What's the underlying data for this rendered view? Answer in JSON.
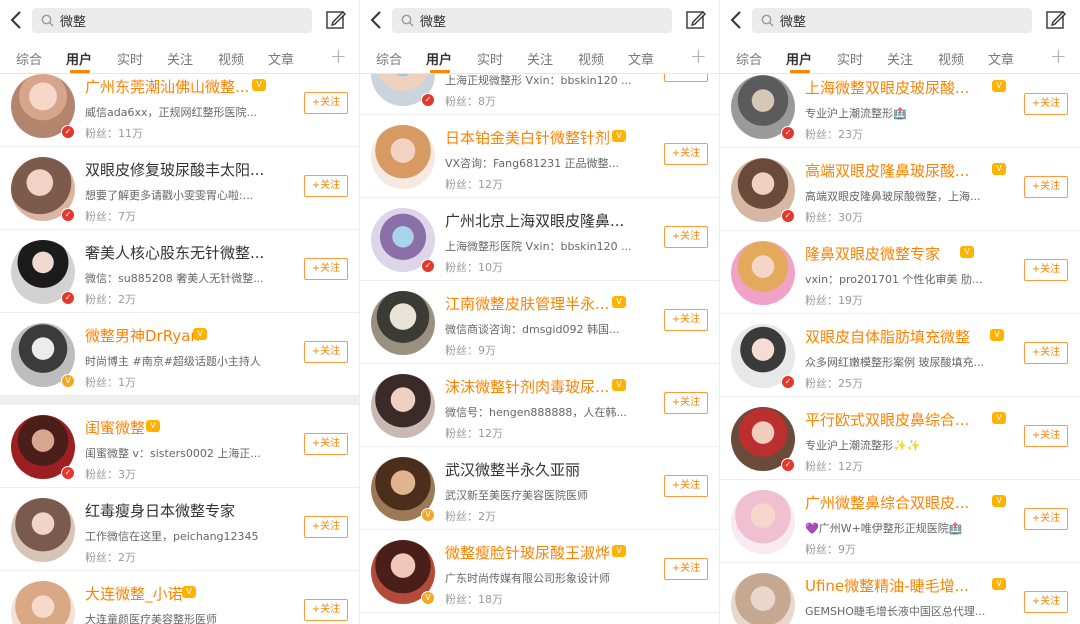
{
  "search": {
    "query": "微整"
  },
  "tabs": [
    "综合",
    "用户",
    "实时",
    "关注",
    "视频",
    "文章"
  ],
  "follow_label": "+关注",
  "colors": {
    "accent": "#ff8200",
    "verified_red": "#e5382c",
    "verified_gold": "#f5a623"
  },
  "panels": [
    {
      "users": [
        {
          "name": "广州东莞潮汕佛山微整...",
          "desc": "威信ada6xx，正规网红整形医院...",
          "fans": "粉丝：11万"
        },
        {
          "name": "双眼皮修复玻尿酸丰太阳...",
          "desc": "想要了解更多请戳小雯雯胃心啦:...",
          "fans": "粉丝：7万"
        },
        {
          "name": "奢美人核心股东无针微整...",
          "desc": "微信：su885208 奢美人无针微整...",
          "fans": "粉丝：2万"
        },
        {
          "name": "微整男神DrRyan",
          "desc": "时尚博主 #南京#超级话题小主持人",
          "fans": "粉丝：1万"
        },
        {
          "name": "闺蜜微整",
          "desc": "闺蜜微整 v：sisters0002 上海正...",
          "fans": "粉丝：3万"
        },
        {
          "name": "红毒瘦身日本微整专家",
          "desc": "工作微信在这里，peichang12345",
          "fans": "粉丝：2万"
        },
        {
          "name": "大连微整_小诺",
          "desc": "大连童颜医疗美容整形医师",
          "fans": ""
        }
      ]
    },
    {
      "users": [
        {
          "name": "",
          "desc": "上海正规微整形 Vxin：bbskin120 ...",
          "fans": "粉丝：8万"
        },
        {
          "name": "日本铂金美白针微整针剂",
          "desc": "VX咨询：Fang681231  正品微整...",
          "fans": "粉丝：12万"
        },
        {
          "name": "广州北京上海双眼皮隆鼻...",
          "desc": "上海微整形医院 Vxin：bbskin120 ...",
          "fans": "粉丝：10万"
        },
        {
          "name": "江南微整皮肤管理半永...",
          "desc": "微信商谈咨询：dmsgid092 韩国...",
          "fans": "粉丝：9万"
        },
        {
          "name": "沫沫微整针剂肉毒玻尿...",
          "desc": "微信号：hengen888888，人在韩...",
          "fans": "粉丝：12万"
        },
        {
          "name": "武汉微整半永久亚丽",
          "desc": "武汉新至美医疗美容医院医师",
          "fans": "粉丝：2万"
        },
        {
          "name": "微整瘦脸针玻尿酸王淑烨",
          "desc": "广东时尚传媒有限公司形象设计师",
          "fans": "粉丝：18万"
        }
      ]
    },
    {
      "users": [
        {
          "name": "上海微整双眼皮玻尿酸...",
          "desc": "专业沪上潮流整形🏥",
          "fans": "粉丝：23万"
        },
        {
          "name": "高端双眼皮隆鼻玻尿酸...",
          "desc": "高端双眼皮隆鼻玻尿酸微整，上海...",
          "fans": "粉丝：30万"
        },
        {
          "name": "隆鼻双眼皮微整专家",
          "desc": "vxin：pro201701 个性化审美 肋...",
          "fans": "粉丝：19万"
        },
        {
          "name": "双眼皮自体脂肪填充微整",
          "desc": "众多网红嫩模整形案例 玻尿酸填充...",
          "fans": "粉丝：25万"
        },
        {
          "name": "平行欧式双眼皮鼻综合...",
          "desc": "专业沪上潮流整形✨✨",
          "fans": "粉丝：12万"
        },
        {
          "name": "广州微整鼻综合双眼皮...",
          "desc": "💜广州W+唯伊整形正规医院🏥",
          "fans": "粉丝：9万"
        },
        {
          "name": "Ufine微整精油-睫毛增...",
          "desc": "GEMSHO睫毛增长液中国区总代理...",
          "fans": ""
        }
      ]
    }
  ]
}
